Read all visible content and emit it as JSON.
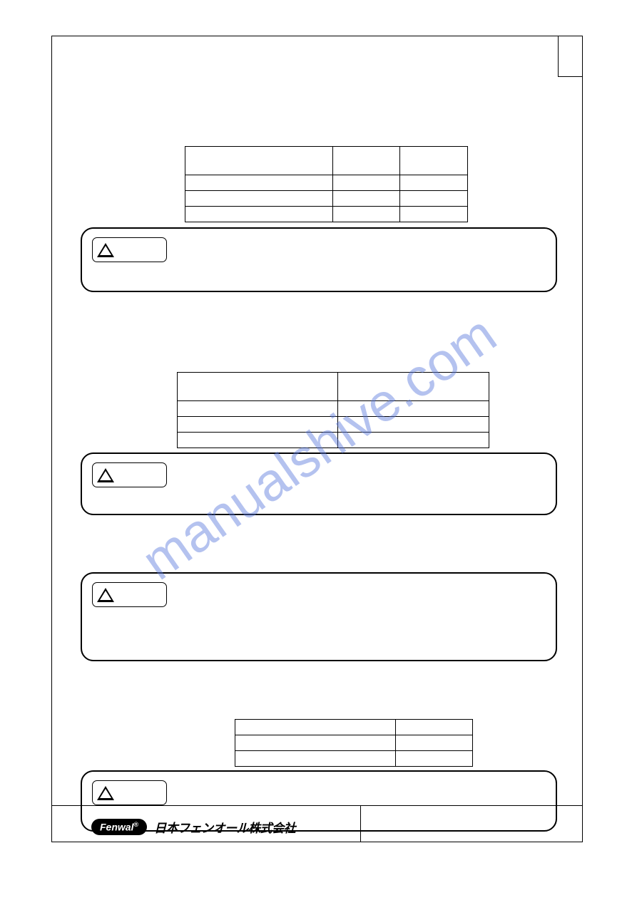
{
  "watermark": "manualshive.com",
  "footer": {
    "brand": "Fenwal",
    "registered": "®",
    "company_jp": "日本フェンオール株式会社"
  }
}
